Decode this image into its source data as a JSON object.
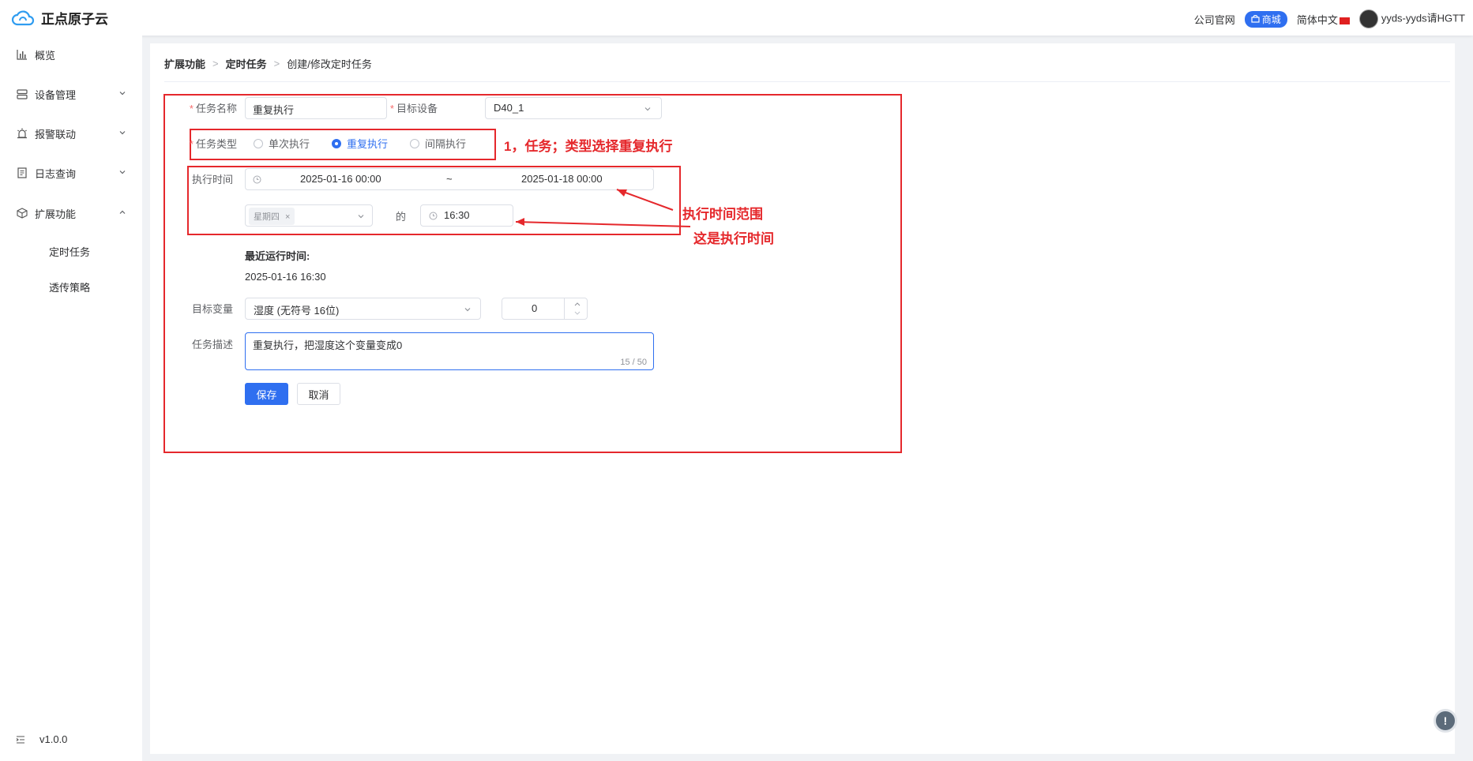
{
  "app": {
    "title": "正点原子云"
  },
  "topbar": {
    "company_site": "公司官网",
    "mall": "商城",
    "language": "简体中文",
    "user": "yyds-yyds请HGTT"
  },
  "sidebar": {
    "items": [
      {
        "label": "概览",
        "icon": "chart-bar-icon"
      },
      {
        "label": "设备管理",
        "icon": "server-icon"
      },
      {
        "label": "报警联动",
        "icon": "alarm-icon"
      },
      {
        "label": "日志查询",
        "icon": "log-icon"
      },
      {
        "label": "扩展功能",
        "icon": "cube-icon"
      }
    ],
    "sub_items": [
      "定时任务",
      "透传策略"
    ],
    "version": "v1.0.0"
  },
  "breadcrumb": {
    "level1": "扩展功能",
    "level2": "定时任务",
    "level3": "创建/修改定时任务"
  },
  "form": {
    "task_name_label": "任务名称",
    "task_name_value": "重复执行",
    "target_device_label": "目标设备",
    "target_device_value": "D40_1",
    "task_type_label": "任务类型",
    "task_type_options": [
      "单次执行",
      "重复执行",
      "间隔执行"
    ],
    "task_type_selected": "重复执行",
    "exec_time_label": "执行时间",
    "range_start": "2025-01-16 00:00",
    "range_sep": "~",
    "range_end": "2025-01-18 00:00",
    "weekday_tag": "星期四",
    "of_label": "的",
    "time_value": "16:30",
    "recent_run_label": "最近运行时间:",
    "recent_run_value": "2025-01-16 16:30",
    "target_var_label": "目标变量",
    "target_var_value": "湿度 (无符号 16位)",
    "target_var_number": "0",
    "desc_label": "任务描述",
    "desc_value": "重复执行，把湿度这个变量变成0",
    "desc_count": "15 / 50",
    "save_button": "保存",
    "cancel_button": "取消"
  },
  "annotations": {
    "note1": "1，任务；类型选择重复执行",
    "note2": "执行时间范围",
    "note3": "这是执行时间"
  },
  "colors": {
    "accent": "#2f6ff0",
    "annotation_red": "#e5282c"
  }
}
